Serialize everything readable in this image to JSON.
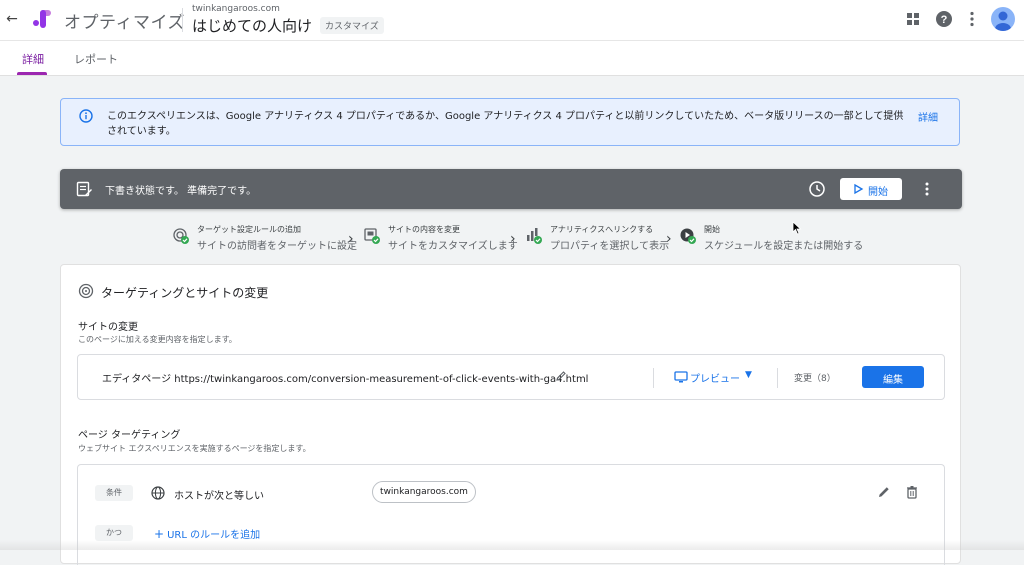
{
  "header": {
    "back_icon": "arrow-left-icon",
    "app_title": "オプティマイズ",
    "site_domain": "twinkangaroos.com",
    "experience_name": "はじめての人向け",
    "experience_type": "カスタマイズ",
    "icons": [
      "apps-grid-icon",
      "help-icon",
      "more-vert-icon",
      "account-avatar"
    ]
  },
  "tabs": [
    {
      "label": "詳細",
      "active": true
    },
    {
      "label": "レポート",
      "active": false
    }
  ],
  "banner": {
    "icon": "info-icon",
    "text": "このエクスペリエンスは、Google アナリティクス 4 プロパティであるか、Google アナリティクス 4 プロパティと以前リンクしていたため、ベータ版リリースの一部として提供されています。",
    "link": "詳細"
  },
  "draft_bar": {
    "status_text": "下書き状態です。 準備完了です。",
    "start_label": "開始",
    "icons": [
      "draft-note-icon",
      "clock-icon",
      "play-icon",
      "more-vert-icon"
    ]
  },
  "steps": [
    {
      "title": "ターゲット設定ルールの追加",
      "subtitle": "サイトの訪問者をターゲットに設定",
      "icon": "target-check-icon"
    },
    {
      "title": "サイトの内容を変更",
      "subtitle": "サイトをカスタマイズします",
      "icon": "page-check-icon"
    },
    {
      "title": "アナリティクスへリンクする",
      "subtitle": "プロパティを選択して表示",
      "icon": "analytics-check-icon"
    },
    {
      "title": "開始",
      "subtitle": "スケジュールを設定または開始する",
      "icon": "play-check-icon"
    }
  ],
  "card": {
    "title": "ターゲティングとサイトの変更",
    "site_changes": {
      "title": "サイトの変更",
      "subtitle": "このページに加える変更内容を指定します。",
      "editor_text": "エディタページ https://twinkangaroos.com/conversion-measurement-of-click-events-with-ga4.html",
      "preview_label": "プレビュー",
      "changes_label": "変更（8）",
      "edit_label": "編集"
    },
    "page_targeting": {
      "title": "ページ ターゲティング",
      "subtitle": "ウェブサイト エクスペリエンスを実施するページを指定します。",
      "condition_chip": "条件",
      "rule_text": "ホストが次と等しい",
      "host_value": "twinkangaroos.com",
      "and_chip": "かつ",
      "add_url_label": "URL のルールを追加"
    }
  },
  "colors": {
    "accent_blue": "#1a73e8",
    "tab_active": "#9c27b0",
    "draft_bar_bg": "#5f6368",
    "banner_bg": "#e8f0fe",
    "check_green": "#34a853"
  }
}
